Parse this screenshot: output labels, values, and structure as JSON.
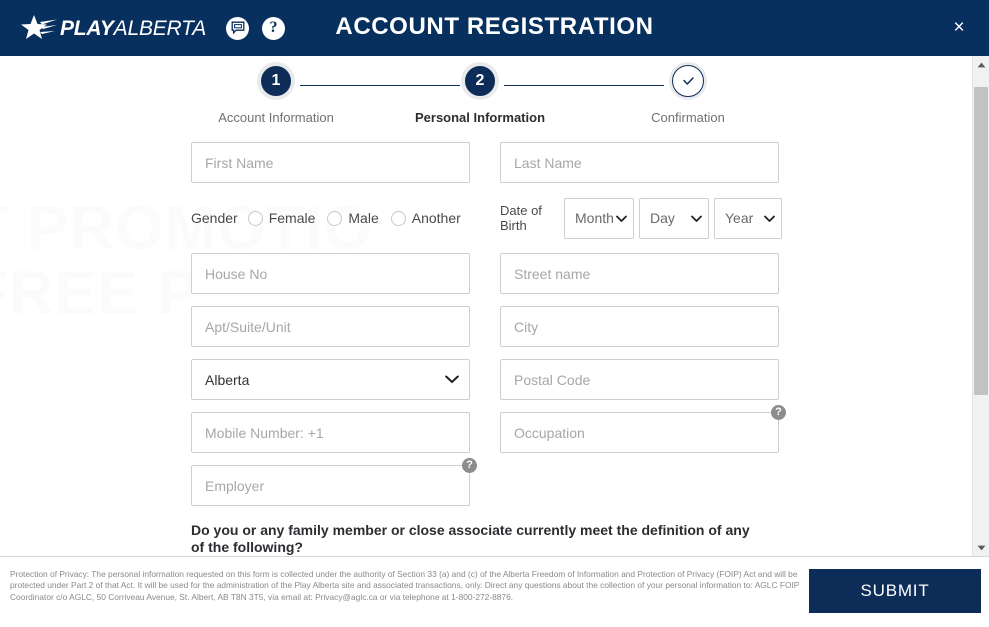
{
  "header": {
    "brand_bold": "PLAY",
    "brand_light": "ALBERTA",
    "chat_icon": "chat-bubble-icon",
    "help_icon": "?",
    "title": "ACCOUNT REGISTRATION",
    "close_icon": "×"
  },
  "watermark": "T PROMOTIO\nFREE P",
  "stepper": {
    "steps": [
      {
        "number": "1",
        "label": "Account Information",
        "state": "complete"
      },
      {
        "number": "2",
        "label": "Personal Information",
        "state": "active"
      },
      {
        "number": "✓",
        "label": "Confirmation",
        "state": "pending"
      }
    ]
  },
  "form": {
    "first_name_placeholder": "First Name",
    "last_name_placeholder": "Last Name",
    "gender_label": "Gender",
    "gender_options": [
      "Female",
      "Male",
      "Another"
    ],
    "dob_label": "Date of Birth",
    "dob_month": "Month",
    "dob_day": "Day",
    "dob_year": "Year",
    "house_no_placeholder": "House No",
    "street_name_placeholder": "Street name",
    "apt_placeholder": "Apt/Suite/Unit",
    "city_placeholder": "City",
    "province_value": "Alberta",
    "postal_code_placeholder": "Postal Code",
    "mobile_placeholder": "Mobile Number: +1",
    "occupation_placeholder": "Occupation",
    "occupation_help": "?",
    "employer_placeholder": "Employer",
    "employer_help": "?",
    "question": "Do you or any family member or close associate currently meet the definition of any of the following?"
  },
  "footer": {
    "privacy_text": "Protection of Privacy: The personal information requested on this form is collected under the authority of Section 33 (a) and (c) of the Alberta Freedom of Information and Protection of Privacy (FOIP) Act and will be protected under Part 2 of that Act. It will be used for the administration of the Play Alberta site and associated transactions, only. Direct any questions about the collection of your personal information to: AGLC FOIP Coordinator c/o AGLC, 50 Corriveau Avenue, St. Albert, AB T8N 3T5, via email at: Privacy@aglc.ca or via telephone at 1-800-272-8876.",
    "submit_label": "SUBMIT"
  },
  "colors": {
    "navy": "#08305f",
    "step_navy": "#0d2d58",
    "border": "#cfcfcf",
    "placeholder": "#a7a7a7",
    "scrollbar_thumb": "#c2c2c2"
  }
}
